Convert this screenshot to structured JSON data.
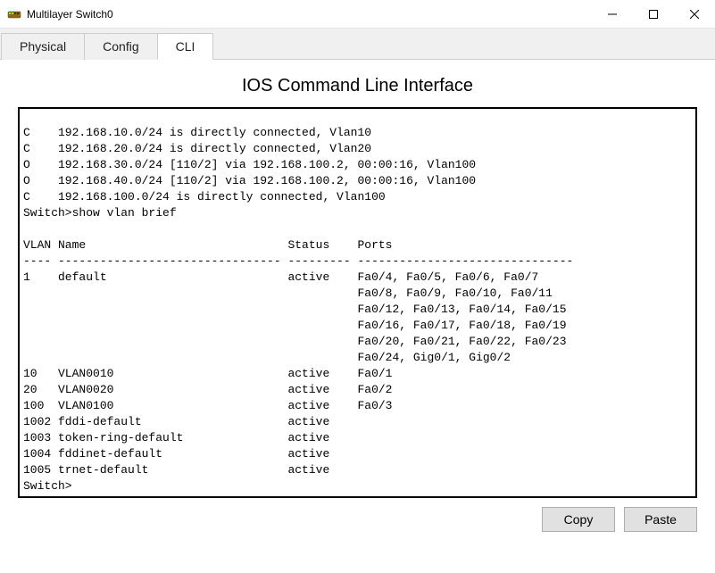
{
  "window": {
    "title": "Multilayer Switch0"
  },
  "tabs": {
    "physical": "Physical",
    "config": "Config",
    "cli": "CLI"
  },
  "cli": {
    "heading": "IOS Command Line Interface",
    "output": "\nC    192.168.10.0/24 is directly connected, Vlan10\nC    192.168.20.0/24 is directly connected, Vlan20\nO    192.168.30.0/24 [110/2] via 192.168.100.2, 00:00:16, Vlan100\nO    192.168.40.0/24 [110/2] via 192.168.100.2, 00:00:16, Vlan100\nC    192.168.100.0/24 is directly connected, Vlan100\nSwitch>show vlan brief\n\nVLAN Name                             Status    Ports\n---- -------------------------------- --------- -------------------------------\n1    default                          active    Fa0/4, Fa0/5, Fa0/6, Fa0/7\n                                                Fa0/8, Fa0/9, Fa0/10, Fa0/11\n                                                Fa0/12, Fa0/13, Fa0/14, Fa0/15\n                                                Fa0/16, Fa0/17, Fa0/18, Fa0/19\n                                                Fa0/20, Fa0/21, Fa0/22, Fa0/23\n                                                Fa0/24, Gig0/1, Gig0/2\n10   VLAN0010                         active    Fa0/1\n20   VLAN0020                         active    Fa0/2\n100  VLAN0100                         active    Fa0/3\n1002 fddi-default                     active    \n1003 token-ring-default               active    \n1004 fddinet-default                  active    \n1005 trnet-default                    active    \nSwitch>"
  },
  "buttons": {
    "copy": "Copy",
    "paste": "Paste"
  }
}
